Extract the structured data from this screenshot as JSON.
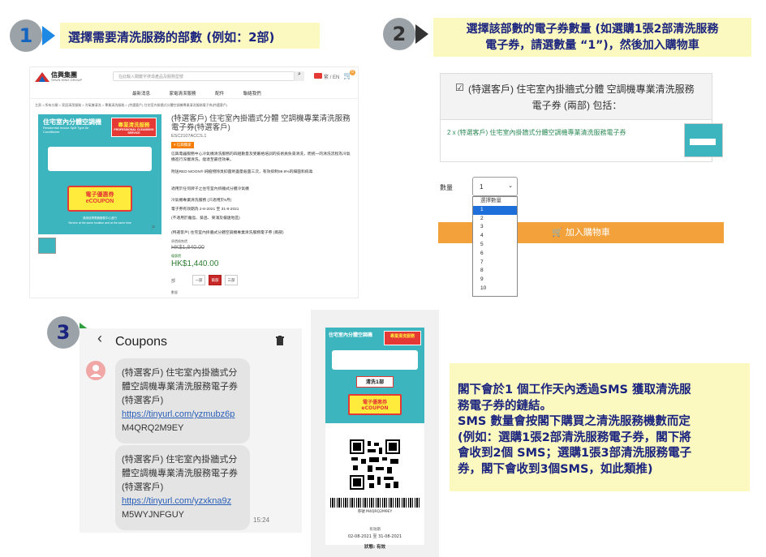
{
  "step1": {
    "number": "1",
    "caption": "選擇需要清洗服務的部數 (例如：2部)",
    "shop": {
      "brand": "信興集團",
      "brand_sub": "SHUN HING GROUP",
      "search_placeholder": "在此輸入關鍵字搜尋產品及服務型號",
      "lang": "繁 / EN",
      "cart_count": "0",
      "nav": [
        "最新消息",
        "家電清潔服務",
        "配件",
        "聯絡我們"
      ],
      "breadcrumb": "主頁 > 所有分類 > 家居清潔服務 > 冷氣機清洗 > 專業清洗服務 > (特選客戶) 住宅室內掛牆式分體空調機專業清洗服務電子券(特選客戶)",
      "product_title": "(特選客戶) 住宅室內掛牆式分體 空調機專業清洗服務電子券(特選客戶)",
      "sku": "ESC2107ACCS.1",
      "badge": "# 信興獨家",
      "desc1": "信興電器服務中心冷氣機清洗服務的四組數量及受嚴格培訓的技術員負責清洗，而統一的清洗流程為冷氣機進行深層清洗，能達至最佳效果。",
      "desc2": "附送RED MOON® 純植物除臭抑菌劑盡量殺菌三次，有效抑制99.9%的細菌和病毒",
      "desc3": "適用於任何牌子之住宅室內掛牆式分體冷氣機",
      "desc4": "冷氣機專業清洗服務 (只適用於8月)",
      "desc5": "電子券有效期為 2-8-2021 至 31-8-2021",
      "desc6": "(不適用於離島、葵昌、東涌及偏遠地區)",
      "desc7": "(特選客戶) 住宅室內掛牆式分體空調機專業清洗服務電子券 (兩部)",
      "old_label": "原價格售價",
      "old_price": "HK$1,840.00",
      "new_label": "優惠價",
      "price": "HK$1,440.00",
      "qty_label": "部",
      "options": [
        "一部",
        "兩部",
        "三部"
      ],
      "note": "數量",
      "image": {
        "title": "住宅室內分體空調機",
        "title_en": "Residential Indoor Split Type Air Conditioner",
        "tag": "專業清洗服務",
        "tag_en": "PROFESSIONAL CLEANSING SERVICE",
        "coupon": "電子優惠券",
        "coupon_en": "eCOUPON",
        "footer": "適用信興電器服務中心進行",
        "footer_en": "Service at the same location and at the same time"
      }
    }
  },
  "step2": {
    "number": "2",
    "caption_line1": "選擇該部數的電子券數量 (如選購1張2部清洗服務",
    "caption_line2": "電子券，請選數量 “1”)，然後加入購物車",
    "package_title_line1": "(特選客戶) 住宅室內掛牆式分體 空調機專業清洗服務",
    "package_title_line2": "電子券 (兩部) 包括：",
    "item_text": "2 x (特選客戶) 住宅室內掛牆式分體空調機專業清洗服務電子券",
    "qty_label": "數量",
    "qty_value": "1",
    "options": [
      "選擇數量",
      "1",
      "2",
      "3",
      "4",
      "5",
      "6",
      "7",
      "8",
      "9",
      "10"
    ],
    "add_to_cart": "加入購物車"
  },
  "step3": {
    "number": "3",
    "header_title": "Coupons",
    "messages": [
      {
        "text": "(特選客戶) 住宅室內掛牆式分體空調機專業清洗服務電子券(特選客戶)",
        "link": "https://tinyurl.com/yzmubz6p",
        "code": "M4QRQ2M9EY"
      },
      {
        "text": "(特選客戶) 住宅室內掛牆式分體空調機專業清洗服務電子券(特選客戶)",
        "link": "https://tinyurl.com/yzxkna9z",
        "code": "M5WYJNFGUY"
      }
    ],
    "time": "15:24"
  },
  "phone": {
    "qty_tag": "清洗1部",
    "code_line": "券號 M4QRQ2M9EY",
    "validity_label": "有效期",
    "validity": "02-08-2021 至 31-08-2021",
    "status_label": "狀態: 有效"
  },
  "info": {
    "line1": "閣下會於1 個工作天內透過SMS 獲取清洗服",
    "line2": "務電子券的鏈結。",
    "line3": "SMS 數量會按閣下購買之清洗服務機數而定",
    "line4": "(例如：選購1張2部清洗服務電子券，閣下將",
    "line5": "會收到2個 SMS；選購1張3部清洗服務電子",
    "line6": "券，閣下會收到3個SMS，如此類推)"
  },
  "colors": {
    "caption_bg": "#fbf8c0",
    "caption_text": "#1a237e",
    "badge_grey": "#9ca3a8",
    "arrow1": "#1e88e5",
    "arrow2": "#333333",
    "arrow3": "#2e9e3e",
    "cart_orange": "#f3a23b",
    "teal": "#3cb5bf"
  }
}
